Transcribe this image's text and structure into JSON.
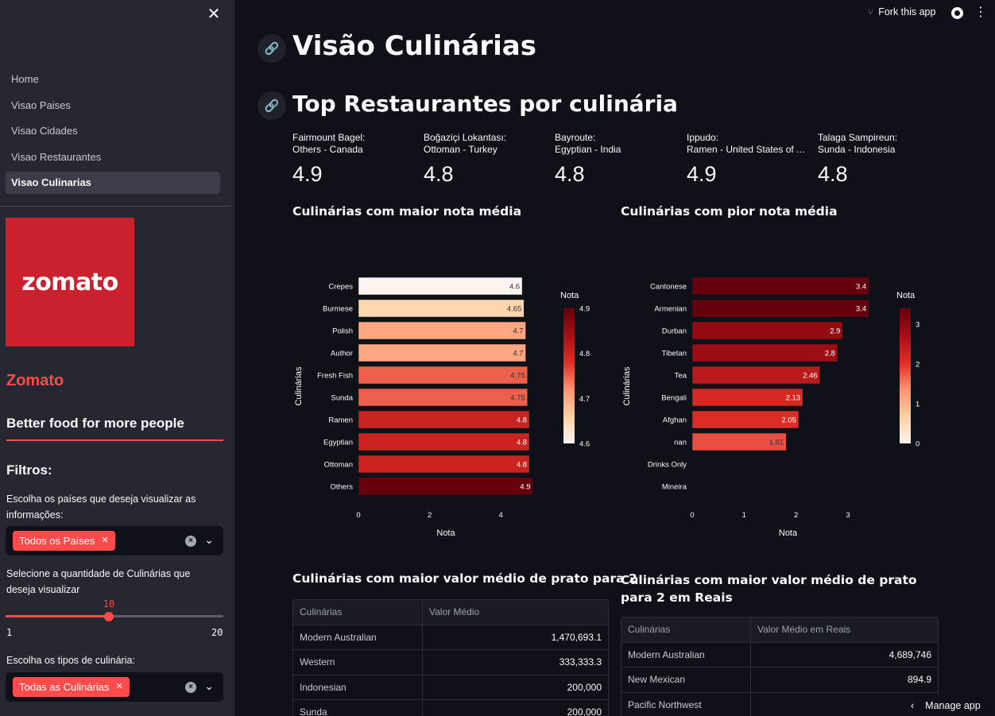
{
  "sidebar": {
    "nav": [
      "Home",
      "Visao Paises",
      "Visao Cidades",
      "Visao Restaurantes",
      "Visao Culinarias"
    ],
    "active_index": 4,
    "logo_text": "zomato",
    "brand": "Zomato",
    "tagline": "Better food for more people",
    "filters_title": "Filtros:",
    "countries_label": "Escolha os países que deseja visualizar as informações:",
    "countries_chip": "Todos os Países",
    "qty_label": "Selecione a quantidade de Culinárias que deseja visualizar",
    "slider": {
      "value": 10,
      "min": 1,
      "max": 20
    },
    "cuisine_label": "Escolha os tipos de culinária:",
    "cuisine_chip": "Todas as Culinárias",
    "colors": {
      "bg": "#262730",
      "accent": "#ff4b4b",
      "logo": "#cb202d"
    }
  },
  "topbar": {
    "fork": "Fork this app",
    "manage": "Manage app"
  },
  "main": {
    "title": "Visão Culinárias",
    "subtitle": "Top Restaurantes por culinária",
    "metrics": [
      {
        "label1": "Fairmount Bagel:",
        "label2": "Others - Canada",
        "value": "4.9"
      },
      {
        "label1": "Boğaziçi Lokantası:",
        "label2": "Ottoman - Turkey",
        "value": "4.8"
      },
      {
        "label1": "Bayroute:",
        "label2": "Egyptian - India",
        "value": "4.8"
      },
      {
        "label1": "Ippudo:",
        "label2": "Ramen - United States of A...",
        "value": "4.9"
      },
      {
        "label1": "Talaga Sampireun:",
        "label2": "Sunda - Indonesia",
        "value": "4.8"
      }
    ],
    "chart1_title": "Culinárias com maior nota média",
    "chart2_title": "Culinárias com pior nota média",
    "table1_title": "Culinárias com maior valor médio de prato para 2",
    "table2_title": "Culinárias com maior valor médio de prato para 2 em Reais",
    "table1": {
      "headers": [
        "Culinárias",
        "Valor Médio"
      ],
      "rows": [
        [
          "Modern Australian",
          "1,470,693.1"
        ],
        [
          "Western",
          "333,333.3"
        ],
        [
          "Indonesian",
          "200,000"
        ],
        [
          "Sunda",
          "200,000"
        ]
      ]
    },
    "table2": {
      "headers": [
        "Culinárias",
        "Valor Médio em Reais"
      ],
      "rows": [
        [
          "Modern Australian",
          "4,689,746"
        ],
        [
          "New Mexican",
          "894.9"
        ],
        [
          "Pacific Northwest",
          ""
        ]
      ]
    }
  },
  "chart_data": [
    {
      "type": "bar",
      "orientation": "horizontal",
      "categories": [
        "Crepes",
        "Burmese",
        "Polish",
        "Author",
        "Fresh Fish",
        "Sunda",
        "Ramen",
        "Egyptian",
        "Ottoman",
        "Others"
      ],
      "values": [
        4.6,
        4.65,
        4.7,
        4.7,
        4.75,
        4.75,
        4.8,
        4.8,
        4.8,
        4.9
      ],
      "xlabel": "Nota",
      "ylabel": "Culinárias",
      "xticks": [
        "0",
        "2",
        "4"
      ],
      "xlim": [
        0,
        5
      ],
      "colorbar": {
        "title": "Nota",
        "ticks": [
          "4.9",
          "4.8",
          "4.7",
          "4.6"
        ],
        "range": [
          4.6,
          4.9
        ]
      }
    },
    {
      "type": "bar",
      "orientation": "horizontal",
      "categories": [
        "Cantonese",
        "Armenian",
        "Durban",
        "Tibetan",
        "Tea",
        "Bengali",
        "Afghan",
        "nan",
        "Drinks Only",
        "Mineira"
      ],
      "values": [
        3.4,
        3.4,
        2.9,
        2.8,
        2.46,
        2.13,
        2.05,
        1.81,
        0,
        0
      ],
      "labels": [
        "3.4",
        "3.4",
        "2.9",
        "2.8",
        "2.46",
        "2.13",
        "2.05",
        "1.81",
        "",
        ""
      ],
      "xlabel": "Nota",
      "ylabel": "Culinárias",
      "xticks": [
        "0",
        "1",
        "2",
        "3"
      ],
      "xlim": [
        0,
        3.75
      ],
      "colorbar": {
        "title": "Nota",
        "ticks": [
          "3",
          "2",
          "1",
          "0"
        ],
        "range": [
          0,
          3.4
        ]
      }
    }
  ]
}
